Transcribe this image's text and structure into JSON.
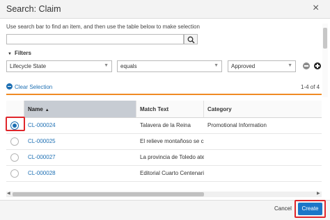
{
  "dialog": {
    "title": "Search: Claim",
    "close_glyph": "×"
  },
  "search": {
    "instructions": "Use search bar to find an item, and then use the table below to make selection",
    "value": "",
    "placeholder": "",
    "button_icon": "search-icon"
  },
  "filters": {
    "label": "Filters",
    "field": "Lifecycle State",
    "operator": "equals",
    "value": "Approved",
    "remove_icon": "minus-circle-icon",
    "add_icon": "plus-circle-icon"
  },
  "selection": {
    "clear_label": "Clear Selection",
    "page_count": "1-4 of 4"
  },
  "table": {
    "columns": [
      {
        "label": "Name",
        "sorted": "ascending"
      },
      {
        "label": "Match Text"
      },
      {
        "label": "Category"
      }
    ],
    "rows": [
      {
        "name": "CL-000024",
        "match": "Talavera de la Reina",
        "category": "Promotional Information",
        "selected": true
      },
      {
        "name": "CL-000025",
        "match": "El relieve montañoso se conoce",
        "category": "",
        "selected": false
      },
      {
        "name": "CL-000027",
        "match": "La provincia de Toledo aterriza",
        "category": "",
        "selected": false
      },
      {
        "name": "CL-000028",
        "match": "Editorial Cuarto Centenario",
        "category": "",
        "selected": false
      }
    ]
  },
  "footer": {
    "cancel_label": "Cancel",
    "create_label": "Create"
  },
  "colors": {
    "accent": "#1d6fb3",
    "primary_button": "#1b76c8",
    "divider": "#f08a24",
    "highlight": "#e0262b"
  }
}
